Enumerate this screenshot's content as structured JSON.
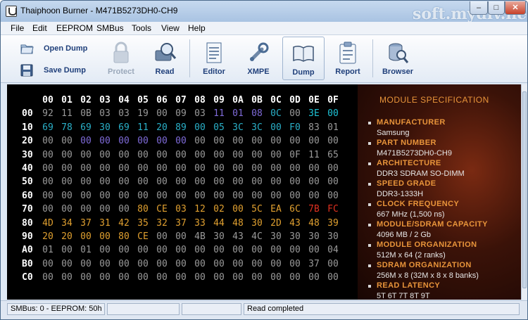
{
  "window": {
    "title": "Thaiphoon Burner - M471B5273DH0-CH9",
    "watermark": "soft.mydiv.net"
  },
  "menu": [
    "File",
    "Edit",
    "EEPROM",
    "SMBus",
    "Tools",
    "View",
    "Help"
  ],
  "toolbar": {
    "open_dump": "Open Dump",
    "save_dump": "Save Dump",
    "protect": "Protect",
    "read": "Read",
    "editor": "Editor",
    "xmpe": "XMPE",
    "dump": "Dump",
    "report": "Report",
    "browser": "Browser"
  },
  "hex": {
    "header": [
      "00",
      "01",
      "02",
      "03",
      "04",
      "05",
      "06",
      "07",
      "08",
      "09",
      "0A",
      "0B",
      "0C",
      "0D",
      "0E",
      "0F"
    ],
    "row_labels": [
      "00",
      "10",
      "20",
      "30",
      "40",
      "50",
      "60",
      "70",
      "80",
      "90",
      "A0",
      "B0",
      "C0"
    ],
    "rows": [
      [
        "92",
        "11",
        "0B",
        "03",
        "03",
        "19",
        "00",
        "09",
        "03",
        "11",
        "01",
        "08",
        "0C",
        "00",
        "3E",
        "00"
      ],
      [
        "69",
        "78",
        "69",
        "30",
        "69",
        "11",
        "20",
        "89",
        "00",
        "05",
        "3C",
        "3C",
        "00",
        "F0",
        "83",
        "01"
      ],
      [
        "00",
        "00",
        "00",
        "00",
        "00",
        "00",
        "00",
        "00",
        "00",
        "00",
        "00",
        "00",
        "00",
        "00",
        "00",
        "00"
      ],
      [
        "00",
        "00",
        "00",
        "00",
        "00",
        "00",
        "00",
        "00",
        "00",
        "00",
        "00",
        "00",
        "00",
        "0F",
        "11",
        "65"
      ],
      [
        "00",
        "00",
        "00",
        "00",
        "00",
        "00",
        "00",
        "00",
        "00",
        "00",
        "00",
        "00",
        "00",
        "00",
        "00",
        "00"
      ],
      [
        "00",
        "00",
        "00",
        "00",
        "00",
        "00",
        "00",
        "00",
        "00",
        "00",
        "00",
        "00",
        "00",
        "00",
        "00",
        "00"
      ],
      [
        "00",
        "00",
        "00",
        "00",
        "00",
        "00",
        "00",
        "00",
        "00",
        "00",
        "00",
        "00",
        "00",
        "00",
        "00",
        "00"
      ],
      [
        "00",
        "00",
        "00",
        "00",
        "00",
        "80",
        "CE",
        "03",
        "12",
        "02",
        "00",
        "5C",
        "EA",
        "6C",
        "7B",
        "FC"
      ],
      [
        "4D",
        "34",
        "37",
        "31",
        "42",
        "35",
        "32",
        "37",
        "33",
        "44",
        "48",
        "30",
        "2D",
        "43",
        "48",
        "39"
      ],
      [
        "20",
        "20",
        "00",
        "00",
        "80",
        "CE",
        "00",
        "00",
        "4B",
        "30",
        "43",
        "4C",
        "30",
        "30",
        "30",
        "30"
      ],
      [
        "01",
        "00",
        "01",
        "00",
        "00",
        "00",
        "00",
        "00",
        "00",
        "00",
        "00",
        "00",
        "00",
        "00",
        "00",
        "04"
      ],
      [
        "00",
        "00",
        "00",
        "00",
        "00",
        "00",
        "00",
        "00",
        "00",
        "00",
        "00",
        "00",
        "00",
        "00",
        "37",
        "00"
      ],
      [
        "00",
        "00",
        "00",
        "00",
        "00",
        "00",
        "00",
        "00",
        "00",
        "00",
        "00",
        "00",
        "00",
        "00",
        "00",
        "00"
      ]
    ],
    "colors": {
      "default": "#9a9a9a",
      "blue": "#2f8fd6",
      "cyan": "#1ec3d6",
      "purple": "#7f6bd9",
      "orange": "#e0a030",
      "red": "#e03020",
      "teal": "#2ab0c8"
    },
    "color_map": [
      [
        "default",
        "default",
        "default",
        "default",
        "default",
        "default",
        "default",
        "default",
        "default",
        "purple",
        "purple",
        "purple",
        "teal",
        "default",
        "cyan",
        "cyan"
      ],
      [
        "teal",
        "teal",
        "teal",
        "teal",
        "teal",
        "teal",
        "teal",
        "teal",
        "teal",
        "teal",
        "teal",
        "teal",
        "teal",
        "teal",
        "default",
        "default"
      ],
      [
        "default",
        "default",
        "purple",
        "purple",
        "purple",
        "purple",
        "purple",
        "purple",
        "default",
        "default",
        "default",
        "default",
        "default",
        "default",
        "default",
        "default"
      ],
      [
        "default",
        "default",
        "default",
        "default",
        "default",
        "default",
        "default",
        "default",
        "default",
        "default",
        "default",
        "default",
        "default",
        "default",
        "default",
        "default"
      ],
      [
        "default",
        "default",
        "default",
        "default",
        "default",
        "default",
        "default",
        "default",
        "default",
        "default",
        "default",
        "default",
        "default",
        "default",
        "default",
        "default"
      ],
      [
        "default",
        "default",
        "default",
        "default",
        "default",
        "default",
        "default",
        "default",
        "default",
        "default",
        "default",
        "default",
        "default",
        "default",
        "default",
        "default"
      ],
      [
        "default",
        "default",
        "default",
        "default",
        "default",
        "default",
        "default",
        "default",
        "default",
        "default",
        "default",
        "default",
        "default",
        "default",
        "default",
        "default"
      ],
      [
        "default",
        "default",
        "default",
        "default",
        "default",
        "orange",
        "orange",
        "orange",
        "orange",
        "orange",
        "orange",
        "orange",
        "orange",
        "orange",
        "red",
        "red"
      ],
      [
        "orange",
        "orange",
        "orange",
        "orange",
        "orange",
        "orange",
        "orange",
        "orange",
        "orange",
        "orange",
        "orange",
        "orange",
        "orange",
        "orange",
        "orange",
        "orange"
      ],
      [
        "orange",
        "orange",
        "orange",
        "orange",
        "orange",
        "orange",
        "default",
        "default",
        "default",
        "default",
        "default",
        "default",
        "default",
        "default",
        "default",
        "default"
      ],
      [
        "default",
        "default",
        "default",
        "default",
        "default",
        "default",
        "default",
        "default",
        "default",
        "default",
        "default",
        "default",
        "default",
        "default",
        "default",
        "default"
      ],
      [
        "default",
        "default",
        "default",
        "default",
        "default",
        "default",
        "default",
        "default",
        "default",
        "default",
        "default",
        "default",
        "default",
        "default",
        "default",
        "default"
      ],
      [
        "default",
        "default",
        "default",
        "default",
        "default",
        "default",
        "default",
        "default",
        "default",
        "default",
        "default",
        "default",
        "default",
        "default",
        "default",
        "default"
      ]
    ]
  },
  "spec": {
    "title": "MODULE SPECIFICATION",
    "items": [
      {
        "label": "MANUFACTURER",
        "value": "Samsung"
      },
      {
        "label": "PART NUMBER",
        "value": "M471B5273DH0-CH9"
      },
      {
        "label": "ARCHITECTURE",
        "value": "DDR3 SDRAM SO-DIMM"
      },
      {
        "label": "SPEED GRADE",
        "value": "DDR3-1333H"
      },
      {
        "label": "CLOCK FREQUENCY",
        "value": "667 MHz (1,500 ns)"
      },
      {
        "label": "MODULE/SDRAM CAPACITY",
        "value": "4096 MB / 2 Gb"
      },
      {
        "label": "MODULE ORGANIZATION",
        "value": "512M x 64 (2 ranks)"
      },
      {
        "label": "SDRAM ORGANIZATION",
        "value": "256M x 8 (32M x 8 x 8 banks)"
      },
      {
        "label": "READ LATENCY",
        "value": "5T 6T 7T 8T 9T"
      }
    ]
  },
  "status": {
    "smbus": "SMBus: 0 - EEPROM: 50h",
    "message": "Read completed"
  }
}
